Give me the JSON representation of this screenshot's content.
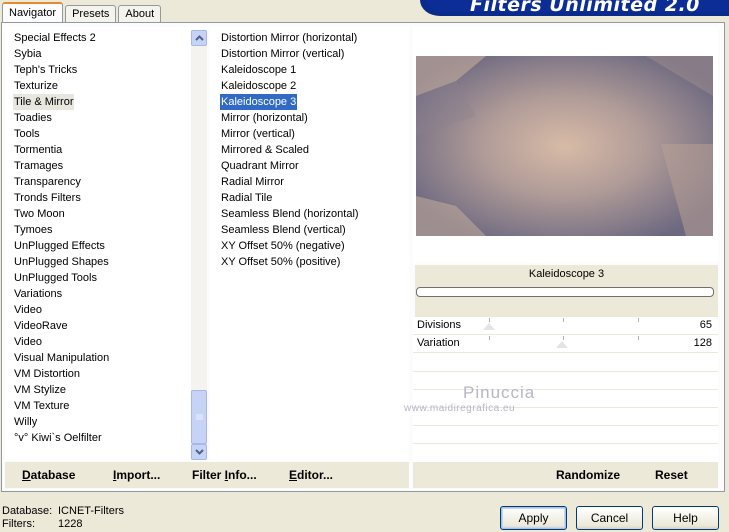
{
  "tabs": [
    {
      "label": "Navigator",
      "active": true
    },
    {
      "label": "Presets",
      "active": false
    },
    {
      "label": "About",
      "active": false
    }
  ],
  "banner": {
    "title": "Filters Unlimited 2.0"
  },
  "categories": [
    "Special Effects 2",
    "Sybia",
    "Teph's Tricks",
    "Texturize",
    "Tile & Mirror",
    "Toadies",
    "Tools",
    "Tormentia",
    "Tramages",
    "Transparency",
    "Tronds Filters",
    "Two Moon",
    "Tymoes",
    "UnPlugged Effects",
    "UnPlugged Shapes",
    "UnPlugged Tools",
    "Variations",
    "Video",
    "VideoRave",
    "Video",
    "Visual Manipulation",
    "VM Distortion",
    "VM Stylize",
    "VM Texture",
    "Willy",
    "°v° Kiwi`s Oelfilter"
  ],
  "selected_category": "Tile & Mirror",
  "filters": [
    "Distortion Mirror (horizontal)",
    "Distortion Mirror (vertical)",
    "Kaleidoscope 1",
    "Kaleidoscope 2",
    "Kaleidoscope 3",
    "Mirror (horizontal)",
    "Mirror (vertical)",
    "Mirrored & Scaled",
    "Quadrant Mirror",
    "Radial Mirror",
    "Radial Tile",
    "Seamless Blend (horizontal)",
    "Seamless Blend (vertical)",
    "XY Offset 50% (negative)",
    "XY Offset 50% (positive)"
  ],
  "selected_filter": "Kaleidoscope 3",
  "preview": {
    "filter_name": "Kaleidoscope 3",
    "progress": 0
  },
  "parameters": [
    {
      "label": "Divisions",
      "value": "65",
      "level": 0.255
    },
    {
      "label": "Variation",
      "value": "128",
      "level": 0.502
    }
  ],
  "watermark": {
    "name": "Pinuccia",
    "url": "www.maidiregrafica.eu"
  },
  "toolbar_left": {
    "database": {
      "label": "Database",
      "mnemonic": "D",
      "rest": "atabase"
    },
    "import": {
      "label": "Import...",
      "mnemonic": "I",
      "rest": "mport..."
    },
    "filter_info": {
      "label": "Filter Info...",
      "pre": "Filter ",
      "mnemonic": "I",
      "rest": "nfo..."
    },
    "editor": {
      "label": "Editor...",
      "mnemonic": "E",
      "rest": "ditor..."
    }
  },
  "toolbar_right": {
    "randomize": "Randomize",
    "reset": "Reset"
  },
  "status": {
    "database_label": "Database:",
    "database_value": "ICNET-Filters",
    "filters_label": "Filters:",
    "filters_value": "1228"
  },
  "buttons": {
    "apply": "Apply",
    "cancel": "Cancel",
    "help": "Help"
  },
  "colors": {
    "selection": "#316ac5",
    "banner": "#0a2a8c",
    "tab_accent": "#e68b2c"
  }
}
